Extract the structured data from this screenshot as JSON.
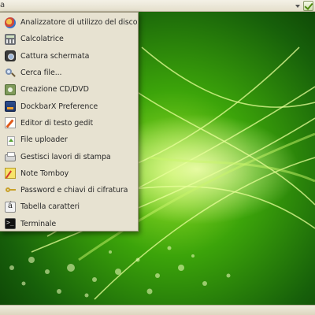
{
  "panel": {
    "menu_label": "a",
    "tray_icons": [
      "dropdown-arrow-icon",
      "update-check-icon"
    ]
  },
  "menu": {
    "items": [
      {
        "label": "Analizzatore di utilizzo del disco",
        "icon": "disk-usage-icon"
      },
      {
        "label": "Calcolatrice",
        "icon": "calculator-icon"
      },
      {
        "label": "Cattura schermata",
        "icon": "screenshot-icon"
      },
      {
        "label": "Cerca file...",
        "icon": "search-icon"
      },
      {
        "label": "Creazione CD/DVD",
        "icon": "cd-dvd-icon"
      },
      {
        "label": "DockbarX Preference",
        "icon": "dockbarx-icon"
      },
      {
        "label": "Editor di testo gedit",
        "icon": "text-editor-icon"
      },
      {
        "label": "File uploader",
        "icon": "file-upload-icon"
      },
      {
        "label": "Gestisci lavori di stampa",
        "icon": "printer-icon"
      },
      {
        "label": "Note Tomboy",
        "icon": "notes-icon"
      },
      {
        "label": "Password e chiavi di cifratura",
        "icon": "keys-icon"
      },
      {
        "label": "Tabella caratteri",
        "icon": "character-map-icon"
      },
      {
        "label": "Terminale",
        "icon": "terminal-icon"
      }
    ]
  },
  "colors": {
    "wallpaper_base": "#1f7a00",
    "wallpaper_glow": "#b7f23a",
    "menu_background": "#e7e2d1",
    "panel_background": "#ece8d8"
  }
}
